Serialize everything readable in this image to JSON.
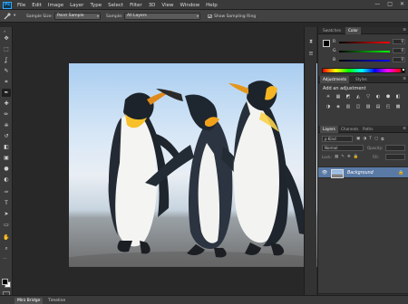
{
  "app": {
    "logo": "Ps"
  },
  "menu": [
    "File",
    "Edit",
    "Image",
    "Layer",
    "Type",
    "Select",
    "Filter",
    "3D",
    "View",
    "Window",
    "Help"
  ],
  "window_controls": {
    "minimize": "—",
    "maximize": "□",
    "close": "✕"
  },
  "options_bar": {
    "sample_size_label": "Sample Size:",
    "sample_size_value": "Point Sample",
    "sample_label": "Sample:",
    "sample_value": "All Layers",
    "show_ring_label": "Show Sampling Ring",
    "show_ring_checked": true
  },
  "tools": [
    "move-tool",
    "marquee-tool",
    "lasso-tool",
    "quick-select-tool",
    "crop-tool",
    "eyedropper-tool",
    "spot-healing-tool",
    "brush-tool",
    "clone-stamp-tool",
    "history-brush-tool",
    "eraser-tool",
    "gradient-tool",
    "blur-tool",
    "dodge-tool",
    "pen-tool",
    "type-tool",
    "path-select-tool",
    "shape-tool",
    "hand-tool",
    "zoom-tool"
  ],
  "tool_glyphs": [
    "✥",
    "⬚",
    "ʆ",
    "✎",
    "⌗",
    "✒",
    "✚",
    "✏",
    "⎈",
    "↺",
    "◧",
    "▣",
    "●",
    "◐",
    "✑",
    "T",
    "➤",
    "▭",
    "✋",
    "⌕"
  ],
  "colors": {
    "foreground": "#000000",
    "background": "#ffffff",
    "accent": "#31a8ff",
    "selection": "#5a7aa6"
  },
  "bottom_tabs": [
    {
      "label": "Mini Bridge",
      "active": true
    },
    {
      "label": "Timeline",
      "active": false
    }
  ],
  "mini_dock": [
    "history-icon",
    "properties-icon"
  ],
  "color_panel": {
    "tabs": [
      {
        "label": "Swatches",
        "active": false
      },
      {
        "label": "Color",
        "active": true
      }
    ],
    "sliders": [
      {
        "label": "R",
        "value": "0",
        "track": "linear-gradient(to right,#000,#f00)"
      },
      {
        "label": "G",
        "value": "0",
        "track": "linear-gradient(to right,#000,#0f0)"
      },
      {
        "label": "B",
        "value": "0",
        "track": "linear-gradient(to right,#000,#00f)"
      }
    ]
  },
  "adjustments_panel": {
    "tabs": [
      {
        "label": "Adjustments",
        "active": true
      },
      {
        "label": "Styles",
        "active": false
      }
    ],
    "heading": "Add an adjustment",
    "row1": [
      "☀",
      "▦",
      "◩",
      "◭",
      "▽",
      "◐",
      "⬢",
      "◧"
    ],
    "row2": [
      "◑",
      "◈",
      "▥",
      "◫",
      "▨",
      "▤",
      "◰",
      "▩"
    ]
  },
  "layers_panel": {
    "tabs": [
      {
        "label": "Layers",
        "active": true
      },
      {
        "label": "Channels",
        "active": false
      },
      {
        "label": "Paths",
        "active": false
      }
    ],
    "kind_label": "ρ Kind",
    "blend_mode": "Normal",
    "opacity_label": "Opacity:",
    "lock_label": "Lock:",
    "fill_label": "Fill:",
    "layers": [
      {
        "name": "Background",
        "visible": true,
        "locked": true
      }
    ],
    "footer_icons": [
      "⛓",
      "fx",
      "◑",
      "◐",
      "▣",
      "▢",
      "🗑"
    ]
  }
}
